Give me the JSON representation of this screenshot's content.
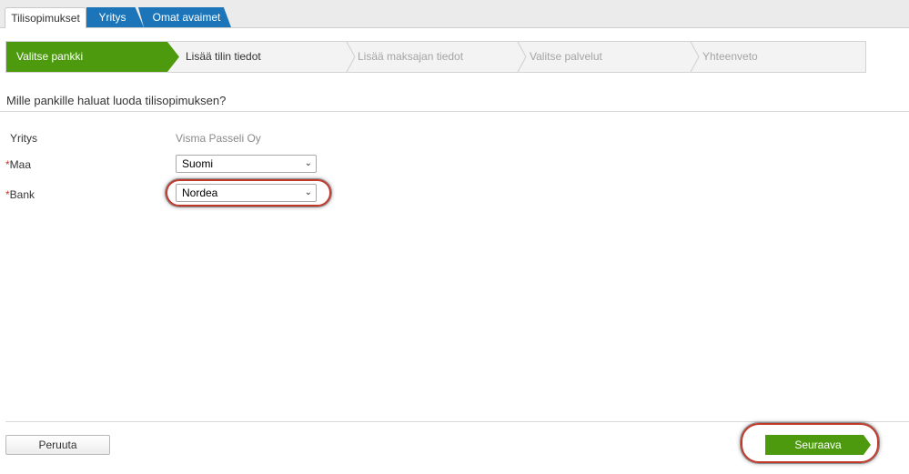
{
  "tabs": [
    {
      "label": "Tilisopimukset"
    },
    {
      "label": "Yritys"
    },
    {
      "label": "Omat avaimet"
    }
  ],
  "wizard": {
    "steps": [
      {
        "label": "Valitse pankki"
      },
      {
        "label": "Lisää tilin tiedot"
      },
      {
        "label": "Lisää maksajan tiedot"
      },
      {
        "label": "Valitse palvelut"
      },
      {
        "label": "Yhteenveto"
      }
    ],
    "current_step": 1
  },
  "heading": "Mille pankille haluat luoda tilisopimuksen?",
  "form": {
    "company_label": "Yritys",
    "company_value": "Visma Passeli Oy",
    "required_mark": "*",
    "country_label": "Maa",
    "country_value": "Suomi",
    "bank_label": "Bank",
    "bank_value": "Nordea"
  },
  "footer": {
    "cancel_label": "Peruuta",
    "next_label": "Seuraava"
  },
  "colors": {
    "accent_green": "#4d9a0f",
    "tab_blue": "#1b75b8",
    "highlight_red": "#c0392b"
  }
}
